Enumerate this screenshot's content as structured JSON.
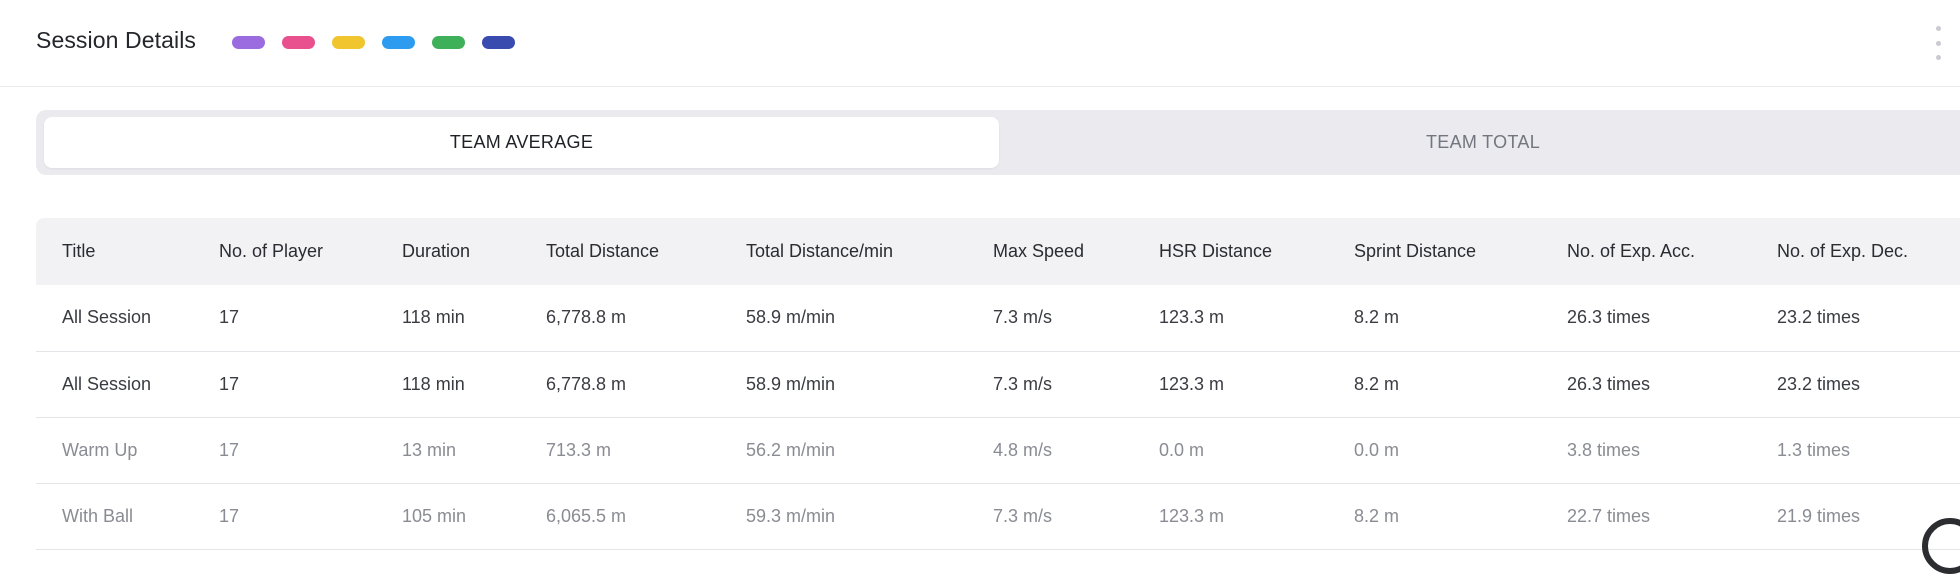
{
  "header": {
    "title": "Session Details",
    "tag_colors": [
      "#9b6be0",
      "#e8508e",
      "#f0c52e",
      "#2d9cf0",
      "#3eb05a",
      "#3a4bb0"
    ]
  },
  "toggle": {
    "options": [
      {
        "label": "TEAM AVERAGE",
        "selected": true
      },
      {
        "label": "TEAM TOTAL",
        "selected": false
      }
    ]
  },
  "table": {
    "columns": [
      "Title",
      "No. of Player",
      "Duration",
      "Total Distance",
      "Total Distance/min",
      "Max Speed",
      "HSR Distance",
      "Sprint Distance",
      "No. of Exp. Acc.",
      "No. of Exp. Dec."
    ],
    "rows": [
      [
        "All Session",
        "17",
        "118 min",
        "6,778.8 m",
        "58.9 m/min",
        "7.3 m/s",
        "123.3 m",
        "8.2 m",
        "26.3 times",
        "23.2 times"
      ],
      [
        "All Session",
        "17",
        "118 min",
        "6,778.8 m",
        "58.9 m/min",
        "7.3 m/s",
        "123.3 m",
        "8.2 m",
        "26.3 times",
        "23.2 times"
      ],
      [
        "Warm Up",
        "17",
        "13 min",
        "713.3 m",
        "56.2 m/min",
        "4.8 m/s",
        "0.0 m",
        "0.0 m",
        "3.8 times",
        "1.3 times"
      ],
      [
        "With Ball",
        "17",
        "105 min",
        "6,065.5 m",
        "59.3 m/min",
        "7.3 m/s",
        "123.3 m",
        "8.2 m",
        "22.7 times",
        "21.9 times"
      ]
    ]
  }
}
